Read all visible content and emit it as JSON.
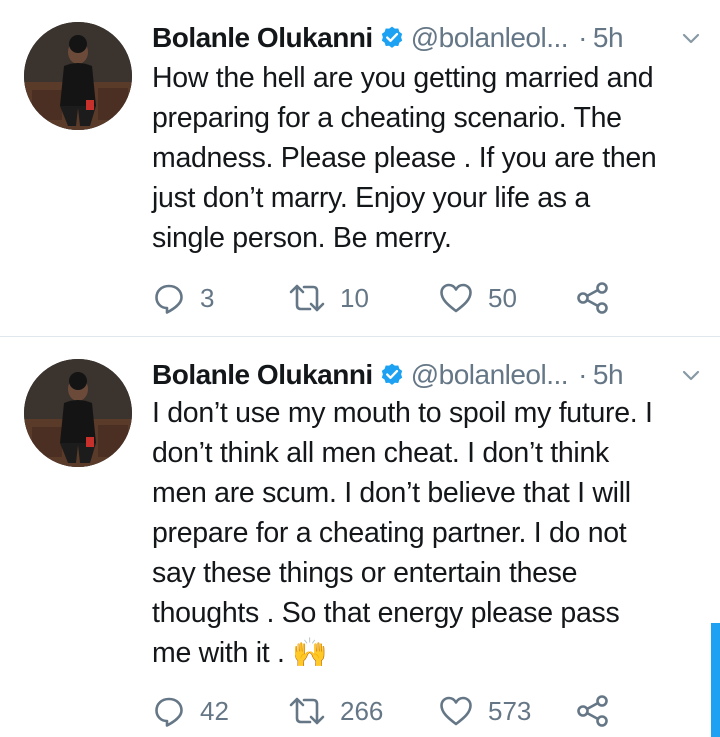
{
  "tweets": [
    {
      "name": "Bolanle Olukanni",
      "handle": "@bolanleol...",
      "dot": "·",
      "time": "5h",
      "lines": [
        "How the hell are you getting married and",
        "preparing for a cheating scenario. The",
        "madness. Please please . If you are then",
        "just don’t marry. Enjoy your life as a",
        "single person. Be merry."
      ],
      "replies": "3",
      "retweets": "10",
      "likes": "50"
    },
    {
      "name": "Bolanle Olukanni",
      "handle": "@bolanleol...",
      "dot": "·",
      "time": "5h",
      "lines": [
        "I don’t use my mouth to spoil my future. I",
        "don’t think all men cheat. I don’t think",
        "men are scum. I don’t believe that I will",
        "prepare for a cheating partner. I do not",
        "say these things or entertain these",
        "thoughts . So that energy please pass",
        "me with it . 🙌"
      ],
      "replies": "42",
      "retweets": "266",
      "likes": "573"
    }
  ],
  "colors": {
    "text": "#14171a",
    "secondary": "#657786",
    "verified": "#1da1f2",
    "divider": "#e1e8ed",
    "scrollbar": "#1da1f2"
  },
  "icons": {
    "verified": "verified-badge-icon",
    "menu": "chevron-down-icon",
    "reply": "reply-icon",
    "retweet": "retweet-icon",
    "like": "heart-icon",
    "share": "share-icon"
  }
}
